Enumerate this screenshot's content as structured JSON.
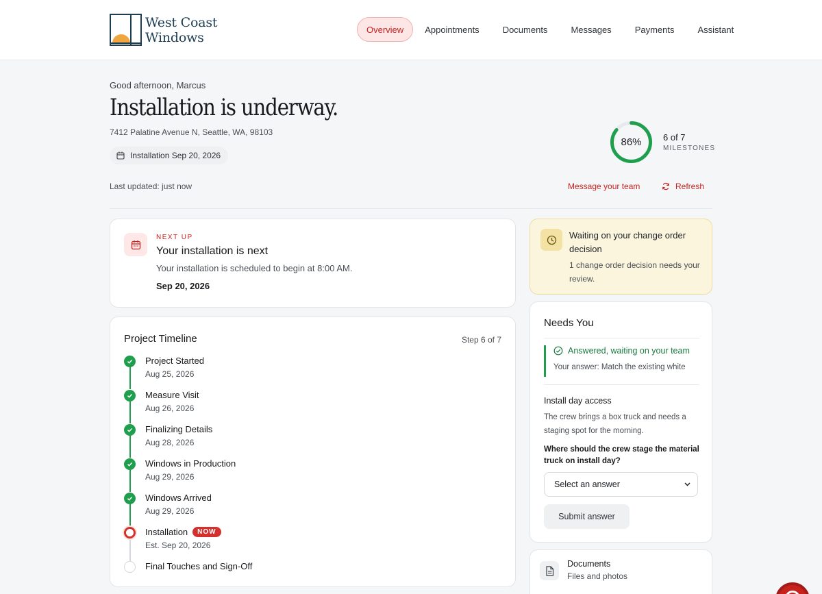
{
  "brand": {
    "line1": "West Coast",
    "line2": "Windows"
  },
  "nav": [
    {
      "label": "Overview",
      "active": true
    },
    {
      "label": "Appointments"
    },
    {
      "label": "Documents"
    },
    {
      "label": "Messages"
    },
    {
      "label": "Payments"
    },
    {
      "label": "Assistant"
    }
  ],
  "hero": {
    "greeting": "Good afternoon, Marcus",
    "title": "Installation is underway.",
    "address": "7412 Palatine Avenue N, Seattle, WA, 98103",
    "install_pill": "Installation Sep 20, 2026",
    "last_updated": "Last updated: just now",
    "progress_percent": 86,
    "progress_label": "86%",
    "milestones_count": "6 of 7",
    "milestones_label": "MILESTONES",
    "message_team": "Message your team",
    "refresh": "Refresh"
  },
  "next_up": {
    "kicker": "NEXT UP",
    "title": "Your installation is next",
    "description": "Your installation is scheduled to begin at 8:00 AM.",
    "date": "Sep 20, 2026"
  },
  "timeline": {
    "title": "Project Timeline",
    "step": "Step 6 of 7",
    "items": [
      {
        "name": "Project Started",
        "date": "Aug 25, 2026",
        "status": "done"
      },
      {
        "name": "Measure Visit",
        "date": "Aug 26, 2026",
        "status": "done"
      },
      {
        "name": "Finalizing Details",
        "date": "Aug 28, 2026",
        "status": "done"
      },
      {
        "name": "Windows in Production",
        "date": "Aug 29, 2026",
        "status": "done"
      },
      {
        "name": "Windows Arrived",
        "date": "Aug 29, 2026",
        "status": "done"
      },
      {
        "name": "Installation",
        "date": "Est. Sep 20, 2026",
        "status": "current",
        "badge": "NOW"
      },
      {
        "name": "Final Touches and Sign-Off",
        "date": "",
        "status": "pending"
      }
    ]
  },
  "waiting": {
    "title": "Waiting on your change order decision",
    "description": "1 change order decision needs your review."
  },
  "needs_you": {
    "title": "Needs You",
    "answered_head": "Answered, waiting on your team",
    "answered_value": "Your answer: Match the existing white",
    "question_title": "Install day access",
    "question_desc": "The crew brings a box truck and needs a staging spot for the morning.",
    "question_prompt": "Where should the crew stage the material truck on install day?",
    "select_value": "Select an answer",
    "submit": "Submit answer"
  },
  "documents": {
    "title": "Documents",
    "subtitle": "Files and photos"
  },
  "colors": {
    "accent_red": "#c8221f",
    "success_green": "#1f9e4d",
    "brand_navy": "#1c3d52",
    "logo_sun": "#f0a640",
    "warning_bg": "#fbf5de"
  }
}
